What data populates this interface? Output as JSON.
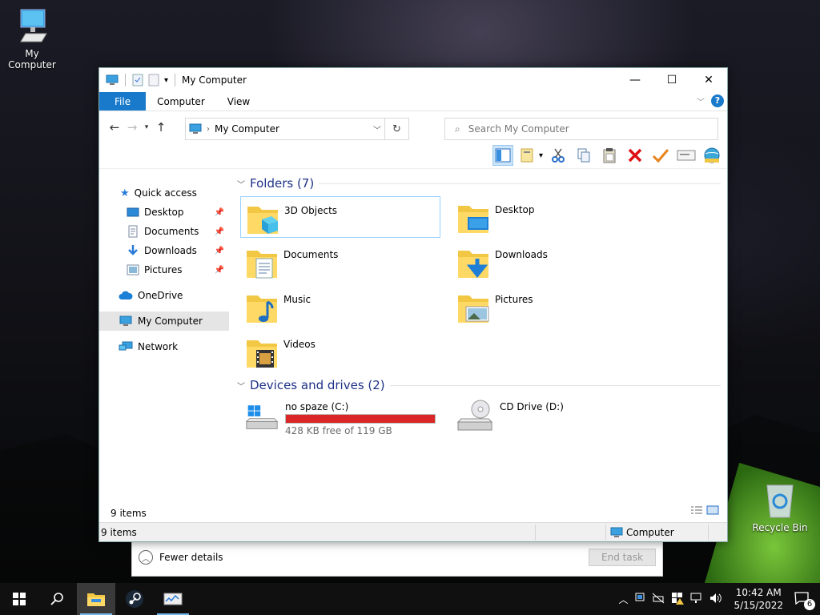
{
  "desktop": {
    "my_computer_label": "My Computer",
    "recycle_bin_label": "Recycle Bin"
  },
  "task_manager": {
    "fewer_details": "Fewer details",
    "end_task": "End task"
  },
  "explorer": {
    "title": "My Computer",
    "ribbon_tabs": [
      "File",
      "Computer",
      "View"
    ],
    "address": "My Computer",
    "search_placeholder": "Search My Computer",
    "nav": {
      "quick_access": "Quick access",
      "desktop": "Desktop",
      "documents": "Documents",
      "downloads": "Downloads",
      "pictures": "Pictures",
      "onedrive": "OneDrive",
      "my_computer": "My Computer",
      "network": "Network"
    },
    "folders_header": "Folders (7)",
    "folders": [
      "3D Objects",
      "Desktop",
      "Documents",
      "Downloads",
      "Music",
      "Pictures",
      "Videos"
    ],
    "devices_header": "Devices and drives (2)",
    "drives": {
      "c_name": "no spaze (C:)",
      "c_free": "428 KB free of 119 GB",
      "c_used_fraction": 0.9999,
      "d_name": "CD Drive (D:)"
    },
    "item_count": "9 items",
    "status_items": "9 items",
    "status_location": "Computer"
  },
  "taskbar": {
    "time": "10:42 AM",
    "date": "5/15/2022",
    "notification_count": "6"
  },
  "colors": {
    "accent": "#1979ca",
    "drive_full": "#da2626",
    "group_header": "#1e3287"
  }
}
